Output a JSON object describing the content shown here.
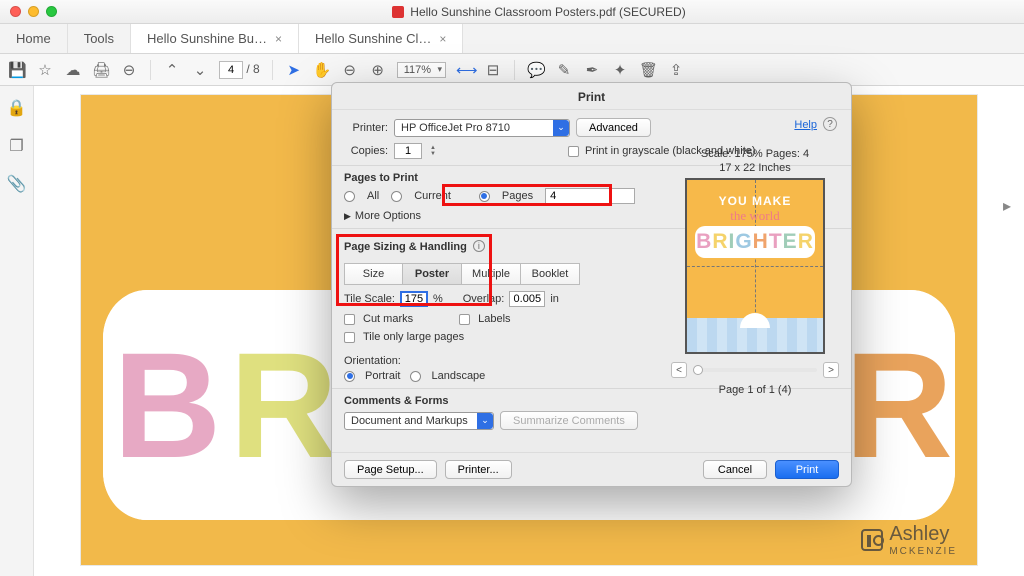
{
  "window": {
    "title": "Hello Sunshine Classroom Posters.pdf (SECURED)"
  },
  "app_tabs": {
    "home": "Home",
    "tools": "Tools",
    "file1": "Hello Sunshine Bu…",
    "file2": "Hello Sunshine Cl…"
  },
  "toolbar": {
    "page_current": "4",
    "page_total": "8",
    "page_sep": "/",
    "zoom": "117%"
  },
  "dialog": {
    "title": "Print",
    "help": "Help",
    "printer_label": "Printer:",
    "printer_value": "HP OfficeJet Pro 8710",
    "advanced": "Advanced",
    "copies_label": "Copies:",
    "copies_value": "1",
    "grayscale": "Print in grayscale (black and white)",
    "pages_to_print": "Pages to Print",
    "opt_all": "All",
    "opt_current": "Current",
    "opt_pages": "Pages",
    "pages_value": "4",
    "more_options": "More Options",
    "sizing_title": "Page Sizing & Handling",
    "seg_size": "Size",
    "seg_poster": "Poster",
    "seg_multiple": "Multiple",
    "seg_booklet": "Booklet",
    "tile_scale_label": "Tile Scale:",
    "tile_scale_value": "175",
    "percent": "%",
    "overlap_label": "Overlap:",
    "overlap_value": "0.005",
    "overlap_unit": "in",
    "cut_marks": "Cut marks",
    "labels": "Labels",
    "tile_large": "Tile only large pages",
    "orientation": "Orientation:",
    "portrait": "Portrait",
    "landscape": "Landscape",
    "comments_title": "Comments & Forms",
    "comments_value": "Document and Markups",
    "summarize": "Summarize Comments",
    "page_setup": "Page Setup...",
    "printer_btn": "Printer...",
    "cancel": "Cancel",
    "print": "Print",
    "preview": {
      "scale": "Scale: 175% Pages: 4",
      "dim": "17 x 22 Inches",
      "pager": "Page 1 of 1 (4)",
      "line1": "YOU MAKE",
      "line2": "the world"
    }
  },
  "poster": {
    "word": "BRIGHTER",
    "colors": [
      "#e7a9c4",
      "#dfe07f",
      "#a6d2bd",
      "#ecc6d6",
      "#a6c5e0",
      "#9fb4c1",
      "#f1d37a",
      "#e9a35c"
    ]
  },
  "watermark": {
    "line1": "Ashley",
    "line2": "MCKENZIE"
  }
}
